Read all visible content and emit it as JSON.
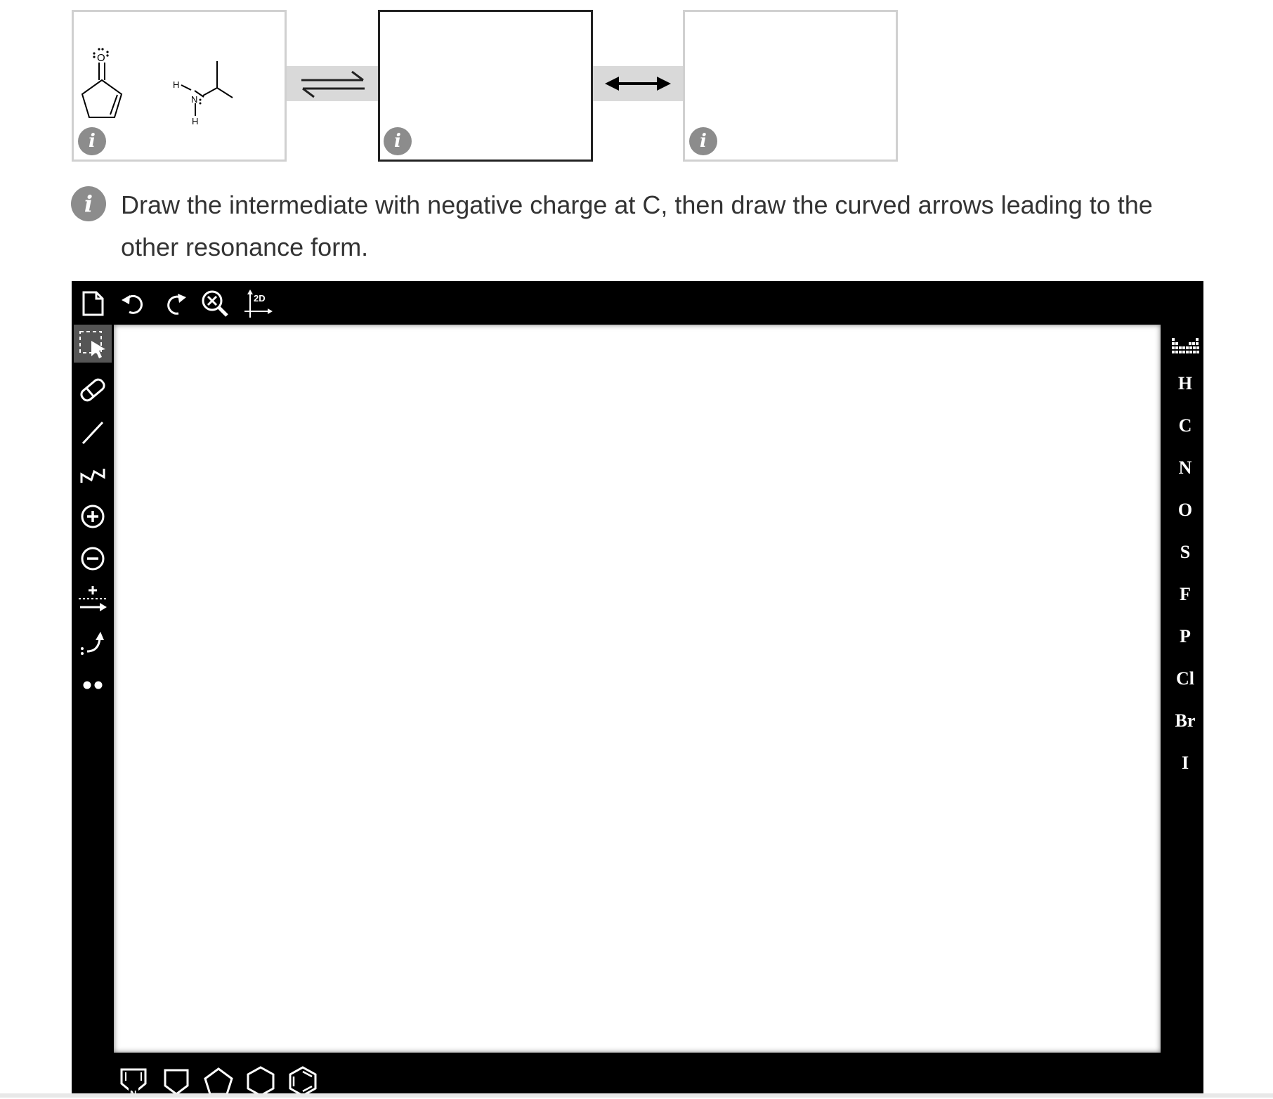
{
  "reaction": {
    "info_glyph": "i",
    "reactant_atoms": {
      "oxygen": "O",
      "amine_h_left": "H",
      "amine_n": "N",
      "amine_h_bottom": "H"
    },
    "connector_1_icon": "equilibrium-arrows-icon",
    "connector_2_icon": "resonance-double-arrow-icon"
  },
  "instruction": {
    "icon_glyph": "i",
    "text": "Draw the intermediate with negative charge at C, then draw the curved arrows leading to the other resonance form."
  },
  "editor": {
    "top_toolbar": [
      {
        "icon": "new-document-icon"
      },
      {
        "icon": "undo-icon"
      },
      {
        "icon": "redo-icon"
      },
      {
        "icon": "zoom-clear-icon"
      },
      {
        "icon": "clean-2d-icon",
        "label": "2D"
      }
    ],
    "left_tools": [
      {
        "icon": "select-lasso-icon",
        "active": true
      },
      {
        "icon": "eraser-icon"
      },
      {
        "icon": "single-bond-icon"
      },
      {
        "icon": "chain-icon"
      },
      {
        "icon": "positive-charge-icon"
      },
      {
        "icon": "negative-charge-icon"
      },
      {
        "icon": "reaction-arrow-icon"
      },
      {
        "icon": "curved-arrow-icon"
      },
      {
        "icon": "lone-pair-icon"
      }
    ],
    "periodic_table_icon": "periodic-table-icon",
    "elements": [
      "H",
      "C",
      "N",
      "O",
      "S",
      "F",
      "P",
      "Cl",
      "Br",
      "I"
    ],
    "bottom_templates": [
      {
        "icon": "pyrrole-template-icon",
        "label": "N"
      },
      {
        "icon": "cyclobutane-template-icon"
      },
      {
        "icon": "cyclopentane-template-icon"
      },
      {
        "icon": "cyclohexane-template-icon"
      },
      {
        "icon": "benzene-template-icon"
      }
    ]
  }
}
